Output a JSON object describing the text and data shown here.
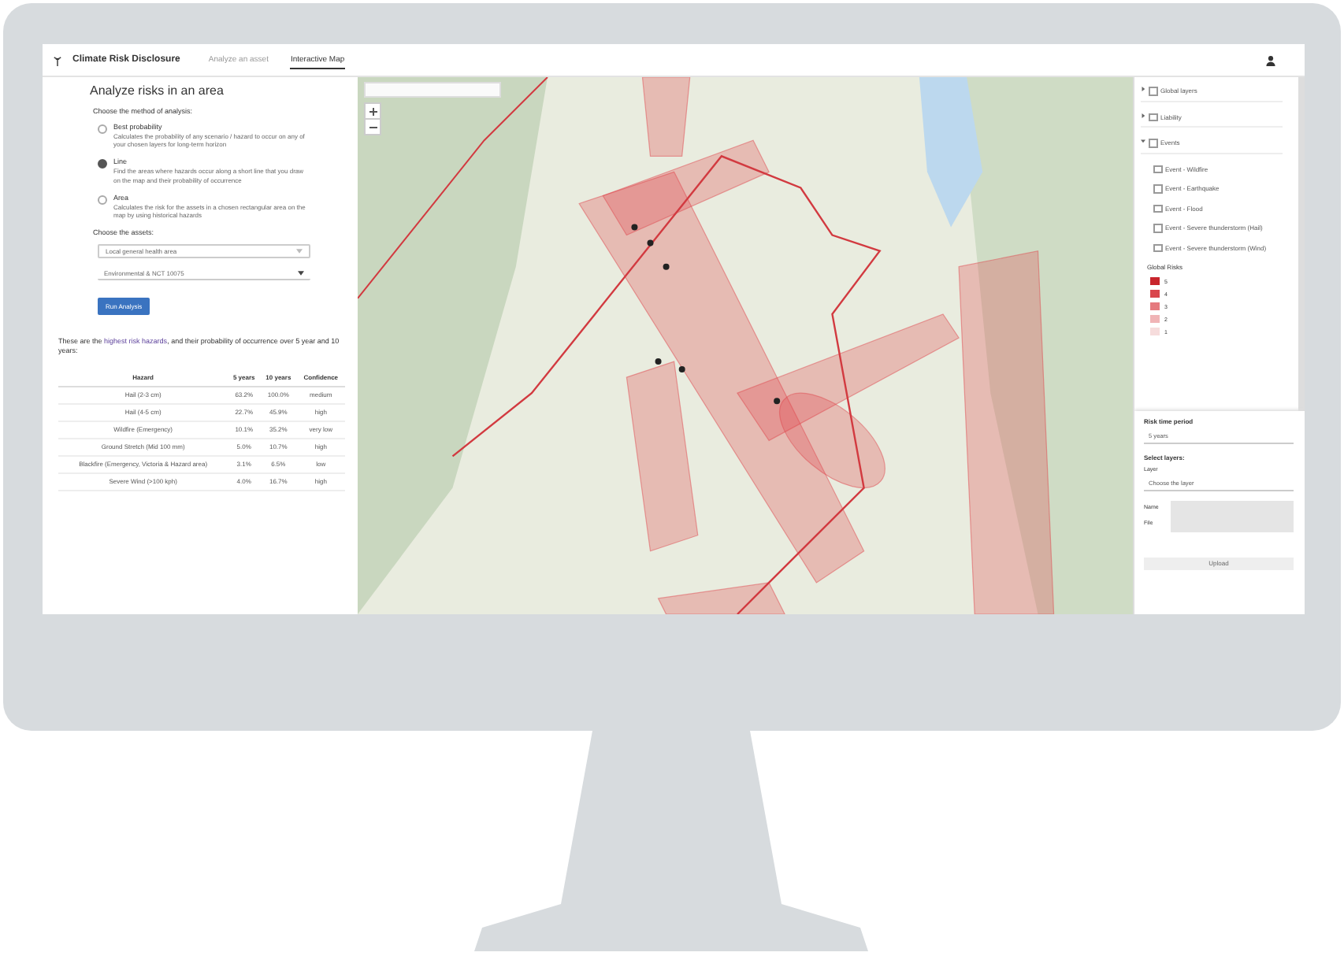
{
  "header": {
    "title": "Climate Risk Disclosure",
    "tabs": [
      {
        "label": "Analyze an asset",
        "selected": false
      },
      {
        "label": "Interactive Map",
        "selected": true
      }
    ]
  },
  "analysis": {
    "title": "Analyze risks in an area",
    "method_label": "Choose the method of analysis:",
    "methods": [
      {
        "label": "Best probability",
        "description": "Calculates the probability of any scenario / hazard to occur on any of your chosen layers for long-term horizon",
        "selected": false
      },
      {
        "label": "Line",
        "description": "Find the areas where hazards occur along a short line that you draw on the map and their probability of occurrence",
        "selected": true
      },
      {
        "label": "Area",
        "description": "Calculates the risk for the assets in a chosen rectangular area on the map by using historical hazards",
        "selected": false
      }
    ],
    "assets_label": "Choose the assets:",
    "selects": [
      {
        "value": "Local general health area"
      },
      {
        "value": "Environmental & NCT 10075"
      }
    ],
    "button": "Run Analysis",
    "summary": "These are the **highest risk hazards**, and their probability of occurrence over 5 year and 10 years:",
    "table": {
      "columns": [
        "Hazard",
        "5 years",
        "10 years",
        "Confidence"
      ],
      "rows": [
        [
          "Hail (2-3 cm)",
          "63.2%",
          "100.0%",
          "medium"
        ],
        [
          "Hail (4-5 cm)",
          "22.7%",
          "45.9%",
          "high"
        ],
        [
          "Wildfire (Emergency)",
          "10.1%",
          "35.2%",
          "very low"
        ],
        [
          "Ground Stretch (Mid 100 mm)",
          "5.0%",
          "10.7%",
          "high"
        ],
        [
          "Blackfire (Emergency, Victoria & Hazard area)",
          "3.1%",
          "6.5%",
          "low"
        ],
        [
          "Severe Wind (>100 kph)",
          "4.0%",
          "16.7%",
          "high"
        ]
      ]
    }
  },
  "layers": {
    "items": [
      {
        "label": "Global layers",
        "expanded": false,
        "checked": false
      },
      {
        "label": "Liability",
        "expanded": false,
        "checked": false
      },
      {
        "label": "Events",
        "expanded": true,
        "checked": false,
        "children": [
          {
            "label": "Event - Wildfire",
            "checked": false
          },
          {
            "label": "Event - Earthquake",
            "checked": false
          },
          {
            "label": "Event - Flood",
            "checked": false
          },
          {
            "label": "Event - Severe thunderstorm (Hail)",
            "checked": false
          },
          {
            "label": "Event - Severe thunderstorm (Wind)",
            "checked": false
          }
        ]
      }
    ],
    "legend_title": "Global Risks",
    "legend": [
      {
        "label": "5",
        "color": "#c8252c"
      },
      {
        "label": "4",
        "color": "#d9464c"
      },
      {
        "label": "3",
        "color": "#e57a7e"
      },
      {
        "label": "2",
        "color": "#f0b4b6"
      },
      {
        "label": "1",
        "color": "#f6dcdc"
      }
    ]
  },
  "controls": {
    "period_label": "Risk time period",
    "period": "5 years",
    "select_layers_label": "Select layers:",
    "layer_label": "Layer",
    "layer_placeholder": "Choose the layer",
    "name_label": "Name",
    "file_label": "File",
    "upload": {
      "label": "Upload",
      "disabled": true
    }
  }
}
